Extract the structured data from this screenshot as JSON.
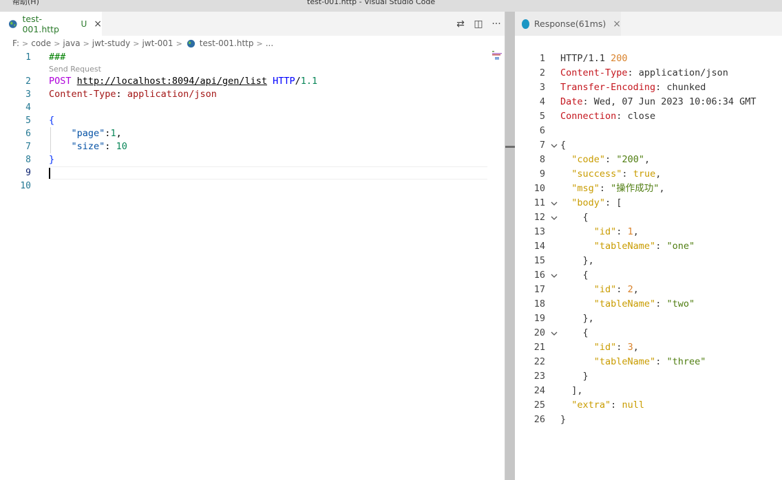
{
  "titlebar": {
    "menu_help": "帮助(H)",
    "window_title": "test-001.http - Visual Studio Code"
  },
  "editor": {
    "tab": {
      "label": "test-001.http",
      "badge": "U",
      "close": "×"
    },
    "actions": {
      "compare": "⇄",
      "split": "◫",
      "more": "···"
    },
    "breadcrumb": [
      "F:",
      "code",
      "java",
      "jwt-study",
      "jwt-001",
      "test-001.http",
      "..."
    ],
    "codelens": "Send Request",
    "lines": [
      {
        "n": "1",
        "t": "###"
      },
      {
        "n": "2",
        "method": "POST",
        "url": "http://localhost:8094/api/gen/list",
        "proto": "HTTP",
        "slash": "/",
        "ver": "1.1"
      },
      {
        "n": "3",
        "hname": "Content-Type",
        "hval": "application/json"
      },
      {
        "n": "4",
        "t": ""
      },
      {
        "n": "5",
        "t": "{"
      },
      {
        "n": "6",
        "key": "\"page\"",
        "val": "1",
        "tail": ","
      },
      {
        "n": "7",
        "key": "\"size\"",
        "val": "10",
        "tail": ""
      },
      {
        "n": "8",
        "t": "}"
      },
      {
        "n": "9",
        "t": ""
      },
      {
        "n": "10",
        "t": ""
      }
    ]
  },
  "response": {
    "tab": {
      "label": "Response(61ms)",
      "close": "×"
    },
    "lines": [
      {
        "n": "1",
        "parts": [
          [
            "HTTP/1.1 ",
            ""
          ],
          [
            "200",
            "r-status"
          ]
        ]
      },
      {
        "n": "2",
        "parts": [
          [
            "Content-Type",
            "r-hname"
          ],
          [
            ": application/json",
            ""
          ]
        ]
      },
      {
        "n": "3",
        "parts": [
          [
            "Transfer-Encoding",
            "r-hname"
          ],
          [
            ": chunked",
            ""
          ]
        ]
      },
      {
        "n": "4",
        "parts": [
          [
            "Date",
            "r-hname"
          ],
          [
            ": Wed, 07 Jun 2023 10:06:34 GMT",
            ""
          ]
        ]
      },
      {
        "n": "5",
        "parts": [
          [
            "Connection",
            "r-hname"
          ],
          [
            ": close",
            ""
          ]
        ]
      },
      {
        "n": "6",
        "parts": [
          [
            "",
            ""
          ]
        ]
      },
      {
        "n": "7",
        "fold": true,
        "parts": [
          [
            "{",
            ""
          ]
        ]
      },
      {
        "n": "8",
        "parts": [
          [
            "  ",
            ""
          ],
          [
            "\"code\"",
            "r-key"
          ],
          [
            ": ",
            ""
          ],
          [
            "\"200\"",
            "r-str"
          ],
          [
            ",",
            ""
          ]
        ]
      },
      {
        "n": "9",
        "parts": [
          [
            "  ",
            ""
          ],
          [
            "\"success\"",
            "r-key"
          ],
          [
            ": ",
            ""
          ],
          [
            "true",
            "r-lit"
          ],
          [
            ",",
            ""
          ]
        ]
      },
      {
        "n": "10",
        "parts": [
          [
            "  ",
            ""
          ],
          [
            "\"msg\"",
            "r-key"
          ],
          [
            ": ",
            ""
          ],
          [
            "\"操作成功\"",
            "r-str"
          ],
          [
            ",",
            ""
          ]
        ]
      },
      {
        "n": "11",
        "fold": true,
        "parts": [
          [
            "  ",
            ""
          ],
          [
            "\"body\"",
            "r-key"
          ],
          [
            ": [",
            ""
          ]
        ]
      },
      {
        "n": "12",
        "fold": true,
        "parts": [
          [
            "    {",
            ""
          ]
        ]
      },
      {
        "n": "13",
        "parts": [
          [
            "      ",
            ""
          ],
          [
            "\"id\"",
            "r-key"
          ],
          [
            ": ",
            ""
          ],
          [
            "1",
            "r-num"
          ],
          [
            ",",
            ""
          ]
        ]
      },
      {
        "n": "14",
        "parts": [
          [
            "      ",
            ""
          ],
          [
            "\"tableName\"",
            "r-key"
          ],
          [
            ": ",
            ""
          ],
          [
            "\"one\"",
            "r-str"
          ]
        ]
      },
      {
        "n": "15",
        "parts": [
          [
            "    },",
            ""
          ]
        ]
      },
      {
        "n": "16",
        "fold": true,
        "parts": [
          [
            "    {",
            ""
          ]
        ]
      },
      {
        "n": "17",
        "parts": [
          [
            "      ",
            ""
          ],
          [
            "\"id\"",
            "r-key"
          ],
          [
            ": ",
            ""
          ],
          [
            "2",
            "r-num"
          ],
          [
            ",",
            ""
          ]
        ]
      },
      {
        "n": "18",
        "parts": [
          [
            "      ",
            ""
          ],
          [
            "\"tableName\"",
            "r-key"
          ],
          [
            ": ",
            ""
          ],
          [
            "\"two\"",
            "r-str"
          ]
        ]
      },
      {
        "n": "19",
        "parts": [
          [
            "    },",
            ""
          ]
        ]
      },
      {
        "n": "20",
        "fold": true,
        "parts": [
          [
            "    {",
            ""
          ]
        ]
      },
      {
        "n": "21",
        "parts": [
          [
            "      ",
            ""
          ],
          [
            "\"id\"",
            "r-key"
          ],
          [
            ": ",
            ""
          ],
          [
            "3",
            "r-num"
          ],
          [
            ",",
            ""
          ]
        ]
      },
      {
        "n": "22",
        "parts": [
          [
            "      ",
            ""
          ],
          [
            "\"tableName\"",
            "r-key"
          ],
          [
            ": ",
            ""
          ],
          [
            "\"three\"",
            "r-str"
          ]
        ]
      },
      {
        "n": "23",
        "parts": [
          [
            "    }",
            ""
          ]
        ]
      },
      {
        "n": "24",
        "parts": [
          [
            "  ],",
            ""
          ]
        ]
      },
      {
        "n": "25",
        "parts": [
          [
            "  ",
            ""
          ],
          [
            "\"extra\"",
            "r-key"
          ],
          [
            ": ",
            ""
          ],
          [
            "null",
            "r-lit"
          ]
        ]
      },
      {
        "n": "26",
        "parts": [
          [
            "}",
            ""
          ]
        ]
      }
    ]
  }
}
